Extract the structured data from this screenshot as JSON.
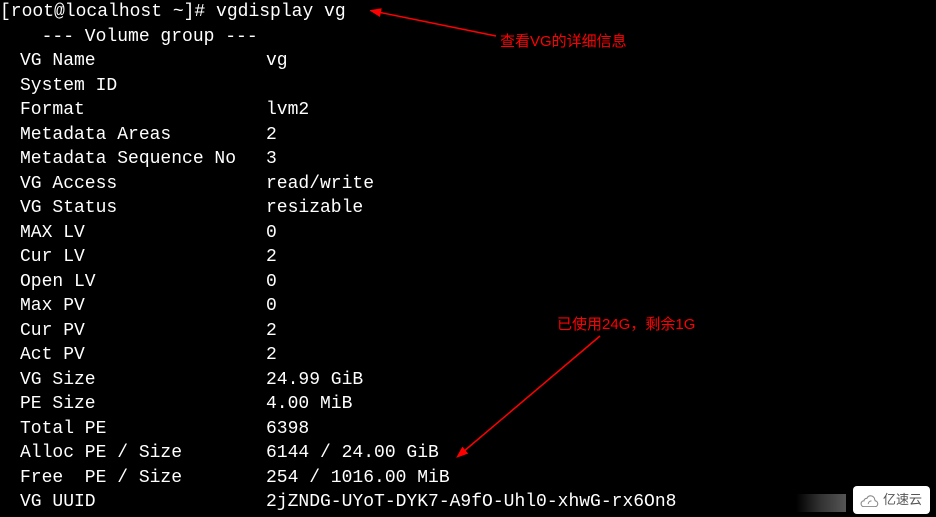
{
  "prompt": "[root@localhost ~]# vgdisplay vg",
  "section_header": "  --- Volume group ---",
  "fields": [
    {
      "label": "VG Name",
      "value": "vg"
    },
    {
      "label": "System ID",
      "value": ""
    },
    {
      "label": "Format",
      "value": "lvm2"
    },
    {
      "label": "Metadata Areas",
      "value": "2"
    },
    {
      "label": "Metadata Sequence No",
      "value": "3"
    },
    {
      "label": "VG Access",
      "value": "read/write"
    },
    {
      "label": "VG Status",
      "value": "resizable"
    },
    {
      "label": "MAX LV",
      "value": "0"
    },
    {
      "label": "Cur LV",
      "value": "2"
    },
    {
      "label": "Open LV",
      "value": "0"
    },
    {
      "label": "Max PV",
      "value": "0"
    },
    {
      "label": "Cur PV",
      "value": "2"
    },
    {
      "label": "Act PV",
      "value": "2"
    },
    {
      "label": "VG Size",
      "value": "24.99 GiB"
    },
    {
      "label": "PE Size",
      "value": "4.00 MiB"
    },
    {
      "label": "Total PE",
      "value": "6398"
    },
    {
      "label": "Alloc PE / Size",
      "value": "6144 / 24.00 GiB"
    },
    {
      "label": "Free  PE / Size",
      "value": "254 / 1016.00 MiB"
    },
    {
      "label": "VG UUID",
      "value": "2jZNDG-UYoT-DYK7-A9fO-Uhl0-xhwG-rx6On8"
    }
  ],
  "annotations": {
    "a1": "查看VG的详细信息",
    "a2": "已使用24G，剩余1G"
  },
  "watermark": "亿速云"
}
